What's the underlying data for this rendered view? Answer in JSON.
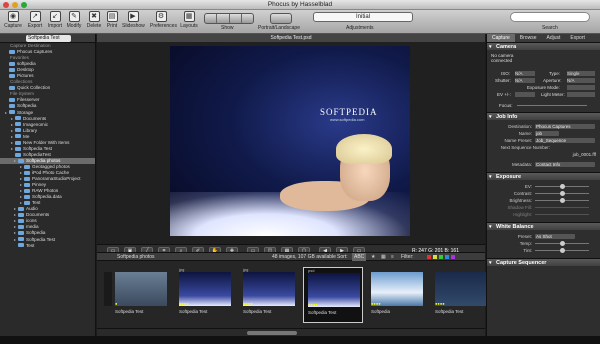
{
  "window": {
    "title": "Phocus by Hasselblad"
  },
  "toolbar": {
    "buttons": [
      {
        "label": "Capture",
        "icon": "camera-icon"
      },
      {
        "label": "Export",
        "icon": "export-icon"
      },
      {
        "label": "Import",
        "icon": "import-icon"
      },
      {
        "label": "Modify",
        "icon": "modify-icon"
      },
      {
        "label": "Delete",
        "icon": "trash-icon"
      },
      {
        "label": "Print",
        "icon": "printer-icon"
      },
      {
        "label": "Slideshow",
        "icon": "slideshow-icon"
      },
      {
        "label": "Preferences",
        "icon": "gear-icon"
      },
      {
        "label": "Layouts",
        "icon": "layout-icon"
      }
    ],
    "show_label": "Show",
    "portrait_label": "Portrait/Landscape",
    "adjustments_value": "Initial",
    "adjustments_label": "Adjustments",
    "search_label": "Search"
  },
  "left": {
    "folder": "Softpedia Test",
    "rows": [
      {
        "t": "Capture Destination",
        "s": 1
      },
      {
        "t": "Phocus Captures"
      },
      {
        "t": "Favorites",
        "s": 1
      },
      {
        "t": "softpedia"
      },
      {
        "t": "Desktop"
      },
      {
        "t": "Pictures"
      },
      {
        "t": "Collections",
        "s": 1
      },
      {
        "t": "Quick Collection"
      },
      {
        "t": "File System",
        "s": 1
      },
      {
        "t": "Filesserver"
      },
      {
        "t": "Softpedia"
      },
      {
        "t": "Storage"
      },
      {
        "t": "Documents"
      },
      {
        "t": "Imagenomic"
      },
      {
        "t": "Library"
      },
      {
        "t": "Me"
      },
      {
        "t": "New Folder With Items"
      },
      {
        "t": "Softpedia Test"
      },
      {
        "t": "SoftpediaTest"
      },
      {
        "t": "Softpedia photos",
        "sel": 1
      },
      {
        "t": "Geotagged photos"
      },
      {
        "t": "iPod Photo Cache"
      },
      {
        "t": "PanoramaStudioProject"
      },
      {
        "t": "Pinney"
      },
      {
        "t": "RAW Photos"
      },
      {
        "t": "Softpedia.data"
      },
      {
        "t": "Test"
      },
      {
        "t": "Audio"
      },
      {
        "t": "Documents"
      },
      {
        "t": "icons"
      },
      {
        "t": "media"
      },
      {
        "t": "Softpedia"
      },
      {
        "t": "Softpedia Test"
      },
      {
        "t": "Test"
      }
    ]
  },
  "viewer": {
    "title": "Softpedia Test.psd",
    "logo": "SOFTPEDIA",
    "logo_sub": "www.softpedia.com",
    "rgb": "R: 247  G: 201  B: 161"
  },
  "browser": {
    "folder": "Softpedia photos",
    "info": "48 images, 107 GB available",
    "sort": "Sort:",
    "sort_value": "ABC",
    "filter": "Filter:",
    "thumbs": [
      {
        "type": "",
        "cap": ""
      },
      {
        "type": "",
        "cap": "Softpedia Test"
      },
      {
        "type": "jpg",
        "cap": "Softpedia Test"
      },
      {
        "type": "jpg",
        "cap": "Softpedia Test"
      },
      {
        "type": "psd",
        "cap": "Softpedia Test"
      },
      {
        "type": "",
        "cap": "Softpedia"
      },
      {
        "type": "",
        "cap": "Softpedia Test"
      }
    ]
  },
  "right": {
    "tabs": [
      "Capture",
      "Browse",
      "Adjust",
      "Export"
    ],
    "camera_title": "Camera",
    "camera_status": "No camera connected",
    "camera_rows": [
      [
        "ISO:",
        "N/A",
        "Type:",
        "Single"
      ],
      [
        "Shutter:",
        "N/A",
        "Aperture:",
        "N/A"
      ]
    ],
    "exposure_mode": "Exposure Mode:",
    "ev": "EV +/-:",
    "light_meter": "Light Meter:",
    "focus": "Focus:",
    "job_title": "Job Info",
    "job_rows": [
      [
        "Destination:",
        "Phocus Captures"
      ],
      [
        "Name:",
        "job"
      ],
      [
        "Name Preset:",
        "Job_Sequence"
      ],
      [
        "Next Sequence Number:",
        "job_0001.fff"
      ],
      [
        "Metadata:",
        "Contact Info"
      ]
    ],
    "exposure_title": "Exposure",
    "exposure_rows": [
      "EV:",
      "Contrast:",
      "Brightness:",
      "Shadow Fill:",
      "Highlight:"
    ],
    "wb_title": "White Balance",
    "wb_preset": "Preset:",
    "wb_preset_value": "As Shot",
    "wb_rows": [
      "Temp:",
      "Tint:"
    ],
    "seq_title": "Capture Sequencer"
  }
}
